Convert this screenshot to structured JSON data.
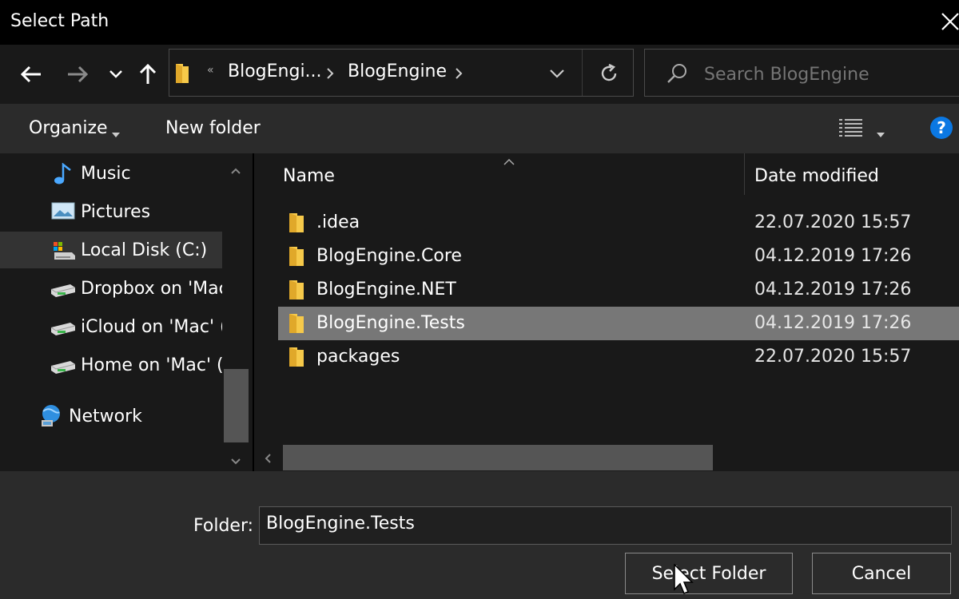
{
  "window": {
    "title": "Select Path"
  },
  "address_bar": {
    "overflow": "«",
    "crumbs": [
      "BlogEngi...",
      "BlogEngine"
    ]
  },
  "search": {
    "placeholder": "Search BlogEngine"
  },
  "toolbar": {
    "organize_label": "Organize",
    "new_folder_label": "New folder",
    "help_label": "?"
  },
  "sidebar": {
    "items": [
      {
        "label": "Music",
        "icon": "music-note-icon"
      },
      {
        "label": "Pictures",
        "icon": "pictures-icon"
      },
      {
        "label": "Local Disk (C:)",
        "icon": "local-disk-icon",
        "selected": true
      },
      {
        "label": "Dropbox on 'Mac",
        "icon": "network-drive-icon"
      },
      {
        "label": "iCloud on 'Mac' (",
        "icon": "network-drive-icon"
      },
      {
        "label": "Home on 'Mac' (",
        "icon": "network-drive-icon"
      },
      {
        "label": "Network",
        "icon": "network-icon"
      }
    ]
  },
  "file_list": {
    "columns": [
      "Name",
      "Date modified"
    ],
    "rows": [
      {
        "name": ".idea",
        "date": "22.07.2020 15:57",
        "icon": "folder-icon"
      },
      {
        "name": "BlogEngine.Core",
        "date": "04.12.2019 17:26",
        "icon": "folder-icon"
      },
      {
        "name": "BlogEngine.NET",
        "date": "04.12.2019 17:26",
        "icon": "folder-icon"
      },
      {
        "name": "BlogEngine.Tests",
        "date": "04.12.2019 17:26",
        "icon": "folder-icon",
        "selected": true
      },
      {
        "name": "packages",
        "date": "22.07.2020 15:57",
        "icon": "folder-icon"
      }
    ]
  },
  "footer": {
    "folder_label": "Folder:",
    "folder_value": "BlogEngine.Tests",
    "select_button": "Select Folder",
    "cancel_button": "Cancel"
  },
  "colors": {
    "selected_row": "#777777",
    "selected_nav": "#333333",
    "help_blue": "#0b78e3",
    "folder_yellow": "#f6c94a"
  }
}
